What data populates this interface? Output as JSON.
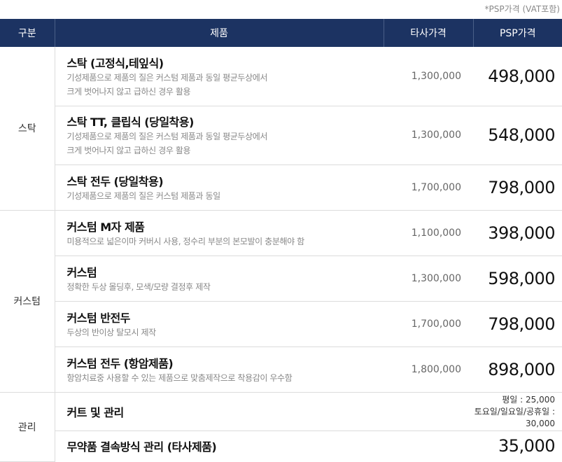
{
  "note": "*PSP가격 (VAT포함)",
  "headers": {
    "category": "구분",
    "product": "제품",
    "other_price": "타사가격",
    "psp_price": "PSP가격"
  },
  "groups": [
    {
      "category": "스탁",
      "rows": [
        {
          "name": "스탁 (고정식,테잎식)",
          "desc": [
            "기성제품으로 제품의 질은 커스텀 제품과 동일 평균두상에서",
            "크게 벗어나지 않고 급하신 경우 활용"
          ],
          "other": "1,300,000",
          "psp": "498,000"
        },
        {
          "name": "스탁 TT, 클립식 (당일착용)",
          "desc": [
            "기성제품으로 제품의 질은 커스텀 제품과 동일 평균두상에서",
            "크게 벗어나지 않고 급하신 경우 활용"
          ],
          "other": "1,300,000",
          "psp": "548,000"
        },
        {
          "name": "스탁 전두 (당일착용)",
          "desc": [
            "기성제품으로 제품의 질은 커스텀 제품과 동일"
          ],
          "other": "1,700,000",
          "psp": "798,000"
        }
      ]
    },
    {
      "category": "커스텀",
      "rows": [
        {
          "name": "커스텀 M자 제품",
          "desc": [
            "미용적으로 넓은이마 커버시 사용, 정수리 부분의 본모발이 충분해야 함"
          ],
          "other": "1,100,000",
          "psp": "398,000"
        },
        {
          "name": "커스텀",
          "desc": [
            "정확한 두상 몰딩후, 모색/모량 결정후 제작"
          ],
          "other": "1,300,000",
          "psp": "598,000"
        },
        {
          "name": "커스텀 반전두",
          "desc": [
            "두상의 반이상 탈모시 제작"
          ],
          "other": "1,700,000",
          "psp": "798,000"
        },
        {
          "name": "커스텀 전두 (항암제품)",
          "desc": [
            "항암치료중 사용할 수 있는 제품으로 맞춤제작으로 착용감이 우수함"
          ],
          "other": "1,800,000",
          "psp": "898,000"
        }
      ]
    },
    {
      "category": "관리",
      "rows": [
        {
          "name": "커트 및 관리",
          "desc": [],
          "other": "",
          "psp_lines": [
            "평일 : 25,000",
            "토요일/일요일/공휴일 : 30,000"
          ]
        },
        {
          "name": "무약품 결속방식 관리 (타사제품)",
          "desc": [],
          "other": "",
          "psp": "35,000"
        }
      ]
    }
  ]
}
